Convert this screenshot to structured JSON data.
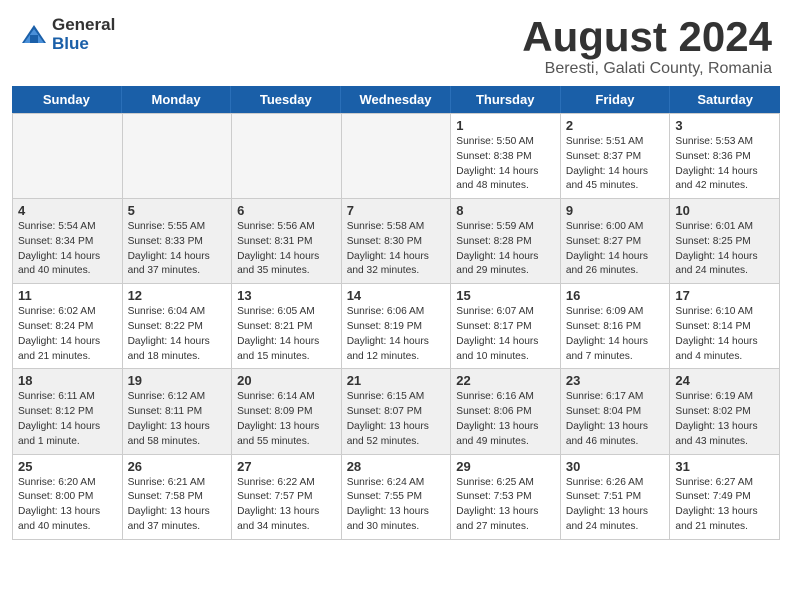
{
  "header": {
    "logo_general": "General",
    "logo_blue": "Blue",
    "month_title": "August 2024",
    "location": "Beresti, Galati County, Romania"
  },
  "day_headers": [
    "Sunday",
    "Monday",
    "Tuesday",
    "Wednesday",
    "Thursday",
    "Friday",
    "Saturday"
  ],
  "weeks": [
    [
      {
        "day": "",
        "text": "",
        "empty": true
      },
      {
        "day": "",
        "text": "",
        "empty": true
      },
      {
        "day": "",
        "text": "",
        "empty": true
      },
      {
        "day": "",
        "text": "",
        "empty": true
      },
      {
        "day": "1",
        "text": "Sunrise: 5:50 AM\nSunset: 8:38 PM\nDaylight: 14 hours\nand 48 minutes.",
        "empty": false
      },
      {
        "day": "2",
        "text": "Sunrise: 5:51 AM\nSunset: 8:37 PM\nDaylight: 14 hours\nand 45 minutes.",
        "empty": false
      },
      {
        "day": "3",
        "text": "Sunrise: 5:53 AM\nSunset: 8:36 PM\nDaylight: 14 hours\nand 42 minutes.",
        "empty": false
      }
    ],
    [
      {
        "day": "4",
        "text": "Sunrise: 5:54 AM\nSunset: 8:34 PM\nDaylight: 14 hours\nand 40 minutes.",
        "empty": false
      },
      {
        "day": "5",
        "text": "Sunrise: 5:55 AM\nSunset: 8:33 PM\nDaylight: 14 hours\nand 37 minutes.",
        "empty": false
      },
      {
        "day": "6",
        "text": "Sunrise: 5:56 AM\nSunset: 8:31 PM\nDaylight: 14 hours\nand 35 minutes.",
        "empty": false
      },
      {
        "day": "7",
        "text": "Sunrise: 5:58 AM\nSunset: 8:30 PM\nDaylight: 14 hours\nand 32 minutes.",
        "empty": false
      },
      {
        "day": "8",
        "text": "Sunrise: 5:59 AM\nSunset: 8:28 PM\nDaylight: 14 hours\nand 29 minutes.",
        "empty": false
      },
      {
        "day": "9",
        "text": "Sunrise: 6:00 AM\nSunset: 8:27 PM\nDaylight: 14 hours\nand 26 minutes.",
        "empty": false
      },
      {
        "day": "10",
        "text": "Sunrise: 6:01 AM\nSunset: 8:25 PM\nDaylight: 14 hours\nand 24 minutes.",
        "empty": false
      }
    ],
    [
      {
        "day": "11",
        "text": "Sunrise: 6:02 AM\nSunset: 8:24 PM\nDaylight: 14 hours\nand 21 minutes.",
        "empty": false
      },
      {
        "day": "12",
        "text": "Sunrise: 6:04 AM\nSunset: 8:22 PM\nDaylight: 14 hours\nand 18 minutes.",
        "empty": false
      },
      {
        "day": "13",
        "text": "Sunrise: 6:05 AM\nSunset: 8:21 PM\nDaylight: 14 hours\nand 15 minutes.",
        "empty": false
      },
      {
        "day": "14",
        "text": "Sunrise: 6:06 AM\nSunset: 8:19 PM\nDaylight: 14 hours\nand 12 minutes.",
        "empty": false
      },
      {
        "day": "15",
        "text": "Sunrise: 6:07 AM\nSunset: 8:17 PM\nDaylight: 14 hours\nand 10 minutes.",
        "empty": false
      },
      {
        "day": "16",
        "text": "Sunrise: 6:09 AM\nSunset: 8:16 PM\nDaylight: 14 hours\nand 7 minutes.",
        "empty": false
      },
      {
        "day": "17",
        "text": "Sunrise: 6:10 AM\nSunset: 8:14 PM\nDaylight: 14 hours\nand 4 minutes.",
        "empty": false
      }
    ],
    [
      {
        "day": "18",
        "text": "Sunrise: 6:11 AM\nSunset: 8:12 PM\nDaylight: 14 hours\nand 1 minute.",
        "empty": false
      },
      {
        "day": "19",
        "text": "Sunrise: 6:12 AM\nSunset: 8:11 PM\nDaylight: 13 hours\nand 58 minutes.",
        "empty": false
      },
      {
        "day": "20",
        "text": "Sunrise: 6:14 AM\nSunset: 8:09 PM\nDaylight: 13 hours\nand 55 minutes.",
        "empty": false
      },
      {
        "day": "21",
        "text": "Sunrise: 6:15 AM\nSunset: 8:07 PM\nDaylight: 13 hours\nand 52 minutes.",
        "empty": false
      },
      {
        "day": "22",
        "text": "Sunrise: 6:16 AM\nSunset: 8:06 PM\nDaylight: 13 hours\nand 49 minutes.",
        "empty": false
      },
      {
        "day": "23",
        "text": "Sunrise: 6:17 AM\nSunset: 8:04 PM\nDaylight: 13 hours\nand 46 minutes.",
        "empty": false
      },
      {
        "day": "24",
        "text": "Sunrise: 6:19 AM\nSunset: 8:02 PM\nDaylight: 13 hours\nand 43 minutes.",
        "empty": false
      }
    ],
    [
      {
        "day": "25",
        "text": "Sunrise: 6:20 AM\nSunset: 8:00 PM\nDaylight: 13 hours\nand 40 minutes.",
        "empty": false
      },
      {
        "day": "26",
        "text": "Sunrise: 6:21 AM\nSunset: 7:58 PM\nDaylight: 13 hours\nand 37 minutes.",
        "empty": false
      },
      {
        "day": "27",
        "text": "Sunrise: 6:22 AM\nSunset: 7:57 PM\nDaylight: 13 hours\nand 34 minutes.",
        "empty": false
      },
      {
        "day": "28",
        "text": "Sunrise: 6:24 AM\nSunset: 7:55 PM\nDaylight: 13 hours\nand 30 minutes.",
        "empty": false
      },
      {
        "day": "29",
        "text": "Sunrise: 6:25 AM\nSunset: 7:53 PM\nDaylight: 13 hours\nand 27 minutes.",
        "empty": false
      },
      {
        "day": "30",
        "text": "Sunrise: 6:26 AM\nSunset: 7:51 PM\nDaylight: 13 hours\nand 24 minutes.",
        "empty": false
      },
      {
        "day": "31",
        "text": "Sunrise: 6:27 AM\nSunset: 7:49 PM\nDaylight: 13 hours\nand 21 minutes.",
        "empty": false
      }
    ]
  ]
}
